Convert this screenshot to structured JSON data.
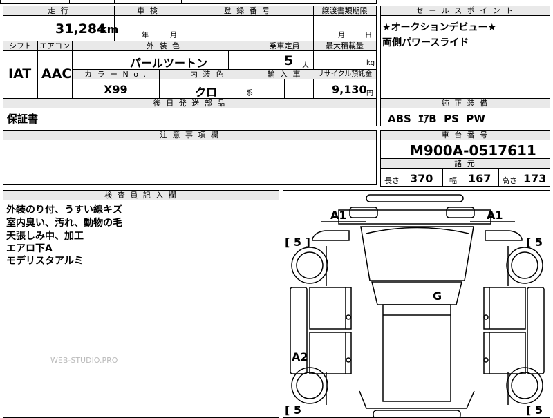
{
  "top": {
    "run_label": "走 行",
    "inspection_label": "車 検",
    "reg_no_label": "登 録 番 号",
    "transfer_label": "譲渡書類期限",
    "sales_label": "セ ー ル ス ポ イ ン ト",
    "mileage_value": "31,284",
    "mileage_unit": "km",
    "year_unit": "年",
    "month_unit": "月",
    "transfer_month": "月",
    "transfer_day": "日"
  },
  "sales_points": [
    "★オークションデビュー★",
    "両側パワースライド"
  ],
  "row2": {
    "shift_label": "シフト",
    "ac_label": "エアコン",
    "exterior_label": "外 装 色",
    "capacity_label": "乗車定員",
    "max_load_label": "最大積載量",
    "shift_value": "IAT",
    "ac_value": "AAC",
    "exterior_value": "パールツートン",
    "capacity_value": "5",
    "capacity_unit": "人",
    "load_unit": "kg"
  },
  "row3": {
    "color_no_label": "カ ラ ー N o .",
    "interior_label": "内 装 色",
    "import_label": "輸 入 車",
    "recycle_label": "リサイクル預託金",
    "color_no_value": "X99",
    "interior_value": "クロ",
    "interior_suffix": "系",
    "recycle_value": "9,130",
    "recycle_unit": "円"
  },
  "later_parts": {
    "label": "後 日 発 送 部 品",
    "value": "保証書"
  },
  "standard_equipment": {
    "label": "純 正 装 備",
    "value": "ABS  ｴｱB  PS  PW"
  },
  "notes": {
    "label": "注 意 事 項 欄"
  },
  "chassis": {
    "label": "車 台 番 号",
    "value": "M900A-0517611"
  },
  "specs": {
    "label": "諸 元",
    "length_label": "長さ",
    "length_value": "370",
    "width_label": "幅",
    "width_value": "167",
    "height_label": "高さ",
    "height_value": "173"
  },
  "inspector": {
    "label": "検 査 員 記 入 欄",
    "lines": [
      "外装のり付、うすい線キズ",
      "室内臭い、汚れ、動物の毛",
      "天張しみ中、加工",
      "エアロ下A",
      "モデリスタアルミ"
    ]
  },
  "watermark": "WEB-STUDIO.PRO",
  "diagram": {
    "marks": {
      "a1_left": "A1",
      "a1_right": "A1",
      "g": "G",
      "a2": "A2",
      "tire_fl": "[ 5 ]",
      "tire_fr": "[ 5",
      "tire_rl": "[ 5",
      "tire_rr": "[ 5"
    }
  }
}
